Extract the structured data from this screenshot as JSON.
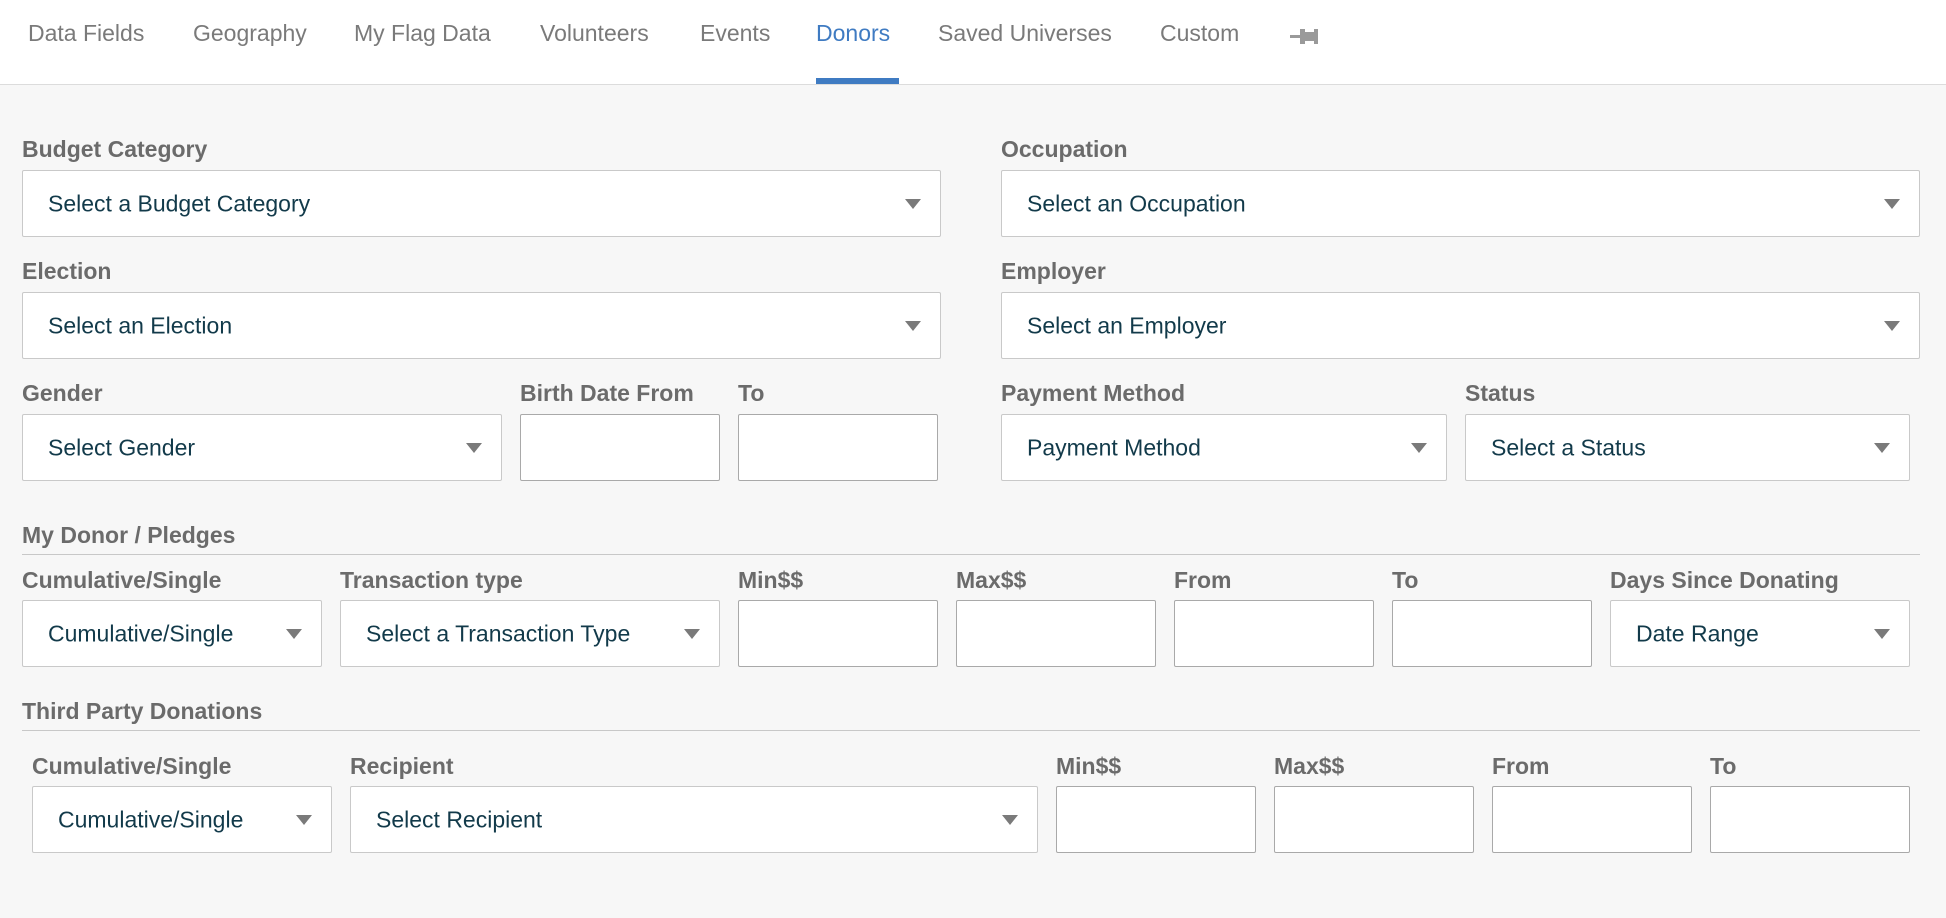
{
  "tabs": [
    {
      "id": "data-fields",
      "label": "Data Fields"
    },
    {
      "id": "geography",
      "label": "Geography"
    },
    {
      "id": "my-flag-data",
      "label": "My Flag Data"
    },
    {
      "id": "volunteers",
      "label": "Volunteers"
    },
    {
      "id": "events",
      "label": "Events"
    },
    {
      "id": "donors",
      "label": "Donors",
      "active": true
    },
    {
      "id": "saved-universes",
      "label": "Saved Universes"
    },
    {
      "id": "custom",
      "label": "Custom"
    }
  ],
  "filters": {
    "budget_category": {
      "label": "Budget Category",
      "value": "Select a Budget Category"
    },
    "occupation": {
      "label": "Occupation",
      "value": "Select an Occupation"
    },
    "election": {
      "label": "Election",
      "value": "Select an Election"
    },
    "employer": {
      "label": "Employer",
      "value": "Select an Employer"
    },
    "gender": {
      "label": "Gender",
      "value": "Select Gender"
    },
    "birth_date_from": {
      "label": "Birth Date From",
      "value": ""
    },
    "birth_date_to": {
      "label": "To",
      "value": ""
    },
    "payment_method": {
      "label": "Payment Method",
      "value": "Payment Method"
    },
    "status": {
      "label": "Status",
      "value": "Select a Status"
    }
  },
  "my_donor": {
    "title": "My Donor / Pledges",
    "cumulative": {
      "label": "Cumulative/Single",
      "value": "Cumulative/Single"
    },
    "transaction_type": {
      "label": "Transaction type",
      "value": "Select a Transaction Type"
    },
    "min": {
      "label": "Min$$",
      "value": ""
    },
    "max": {
      "label": "Max$$",
      "value": ""
    },
    "from": {
      "label": "From",
      "value": ""
    },
    "to": {
      "label": "To",
      "value": ""
    },
    "days_since": {
      "label": "Days Since Donating",
      "value": "Date Range"
    }
  },
  "third_party": {
    "title": "Third Party Donations",
    "cumulative": {
      "label": "Cumulative/Single",
      "value": "Cumulative/Single"
    },
    "recipient": {
      "label": "Recipient",
      "value": "Select Recipient"
    },
    "min": {
      "label": "Min$$",
      "value": ""
    },
    "max": {
      "label": "Max$$",
      "value": ""
    },
    "from": {
      "label": "From",
      "value": ""
    },
    "to": {
      "label": "To",
      "value": ""
    }
  },
  "colors": {
    "accent": "#3f7bc2",
    "label": "#6b6b6b",
    "value_text": "#123a4a"
  }
}
